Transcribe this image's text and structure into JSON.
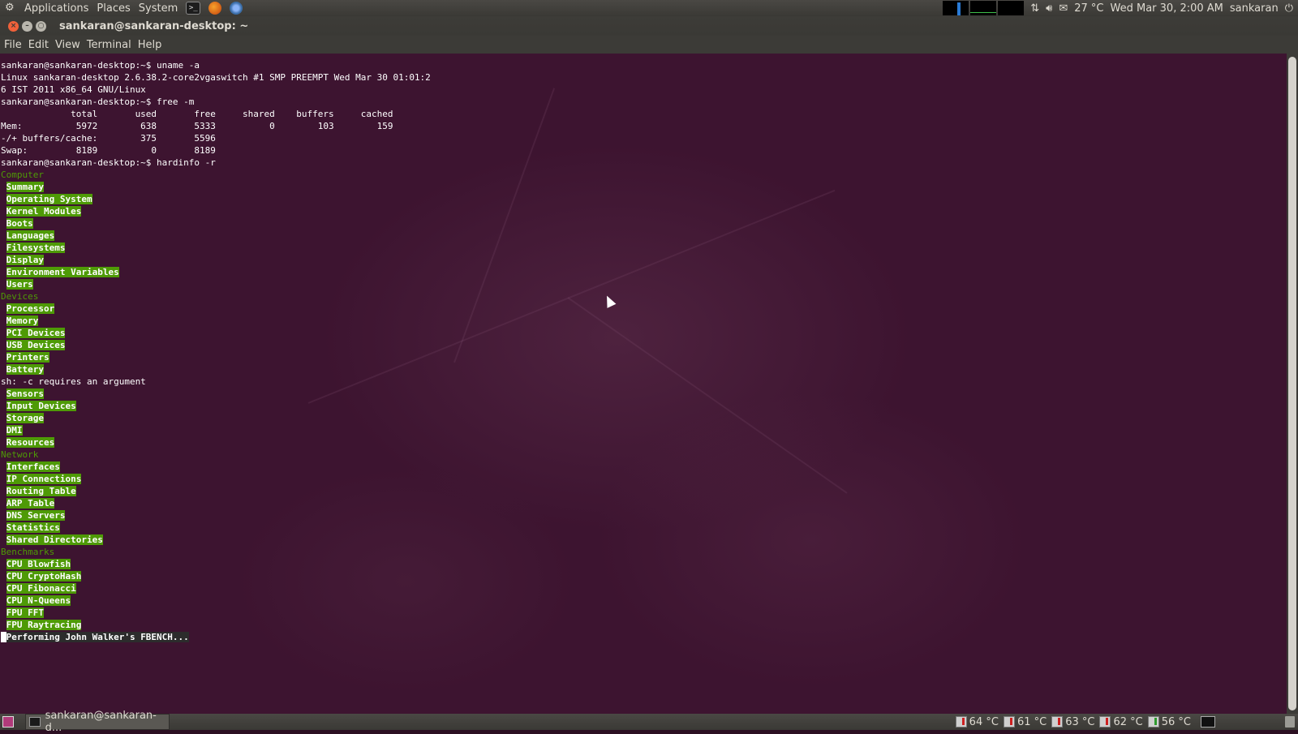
{
  "top_panel": {
    "menus": [
      "Applications",
      "Places",
      "System"
    ],
    "tray": {
      "weather": "27 °C",
      "clock": "Wed Mar 30,  2:00 AM",
      "user": "sankaran"
    }
  },
  "window": {
    "title": "sankaran@sankaran-desktop: ~",
    "menus": [
      "File",
      "Edit",
      "View",
      "Terminal",
      "Help"
    ]
  },
  "terminal": {
    "lines": [
      {
        "type": "plain",
        "text": "sankaran@sankaran-desktop:~$ uname -a"
      },
      {
        "type": "plain",
        "text": "Linux sankaran-desktop 2.6.38.2-core2vgaswitch #1 SMP PREEMPT Wed Mar 30 01:01:2"
      },
      {
        "type": "plain",
        "text": "6 IST 2011 x86_64 GNU/Linux"
      },
      {
        "type": "plain",
        "text": "sankaran@sankaran-desktop:~$ free -m"
      },
      {
        "type": "plain",
        "text": "             total       used       free     shared    buffers     cached"
      },
      {
        "type": "plain",
        "text": "Mem:          5972        638       5333          0        103        159"
      },
      {
        "type": "plain",
        "text": "-/+ buffers/cache:        375       5596"
      },
      {
        "type": "plain",
        "text": "Swap:         8189          0       8189"
      },
      {
        "type": "plain",
        "text": "sankaran@sankaran-desktop:~$ hardinfo -r"
      },
      {
        "type": "section",
        "text": "Computer"
      },
      {
        "type": "item",
        "text": "Summary"
      },
      {
        "type": "item",
        "text": "Operating System"
      },
      {
        "type": "item",
        "text": "Kernel Modules"
      },
      {
        "type": "item",
        "text": "Boots"
      },
      {
        "type": "item",
        "text": "Languages"
      },
      {
        "type": "item",
        "text": "Filesystems"
      },
      {
        "type": "item",
        "text": "Display"
      },
      {
        "type": "item",
        "text": "Environment Variables"
      },
      {
        "type": "item",
        "text": "Users"
      },
      {
        "type": "section",
        "text": "Devices"
      },
      {
        "type": "item",
        "text": "Processor"
      },
      {
        "type": "item",
        "text": "Memory"
      },
      {
        "type": "item",
        "text": "PCI Devices"
      },
      {
        "type": "item",
        "text": "USB Devices"
      },
      {
        "type": "item",
        "text": "Printers"
      },
      {
        "type": "item",
        "text": "Battery"
      },
      {
        "type": "plain",
        "text": "sh: -c requires an argument"
      },
      {
        "type": "item",
        "text": "Sensors"
      },
      {
        "type": "item",
        "text": "Input Devices"
      },
      {
        "type": "item",
        "text": "Storage"
      },
      {
        "type": "item",
        "text": "DMI"
      },
      {
        "type": "item",
        "text": "Resources"
      },
      {
        "type": "section",
        "text": "Network"
      },
      {
        "type": "item",
        "text": "Interfaces"
      },
      {
        "type": "item",
        "text": "IP Connections"
      },
      {
        "type": "item",
        "text": "Routing Table"
      },
      {
        "type": "item",
        "text": "ARP Table"
      },
      {
        "type": "item",
        "text": "DNS Servers"
      },
      {
        "type": "item",
        "text": "Statistics"
      },
      {
        "type": "item",
        "text": "Shared Directories"
      },
      {
        "type": "section",
        "text": "Benchmarks"
      },
      {
        "type": "item",
        "text": "CPU Blowfish"
      },
      {
        "type": "item",
        "text": "CPU CryptoHash"
      },
      {
        "type": "item",
        "text": "CPU Fibonacci"
      },
      {
        "type": "item",
        "text": "CPU N-Queens"
      },
      {
        "type": "item",
        "text": "FPU FFT"
      },
      {
        "type": "item",
        "text": "FPU Raytracing"
      },
      {
        "type": "current",
        "text": "Performing John Walker's FBENCH..."
      }
    ]
  },
  "bottom_panel": {
    "task_label": "sankaran@sankaran-d...",
    "temps": [
      "64 °C",
      "61 °C",
      "63 °C",
      "62 °C",
      "56 °C"
    ]
  },
  "colors": {
    "terminal_bg": "#3d1430",
    "section_green": "#4e9a06",
    "panel_bg": "#3c3b37"
  }
}
